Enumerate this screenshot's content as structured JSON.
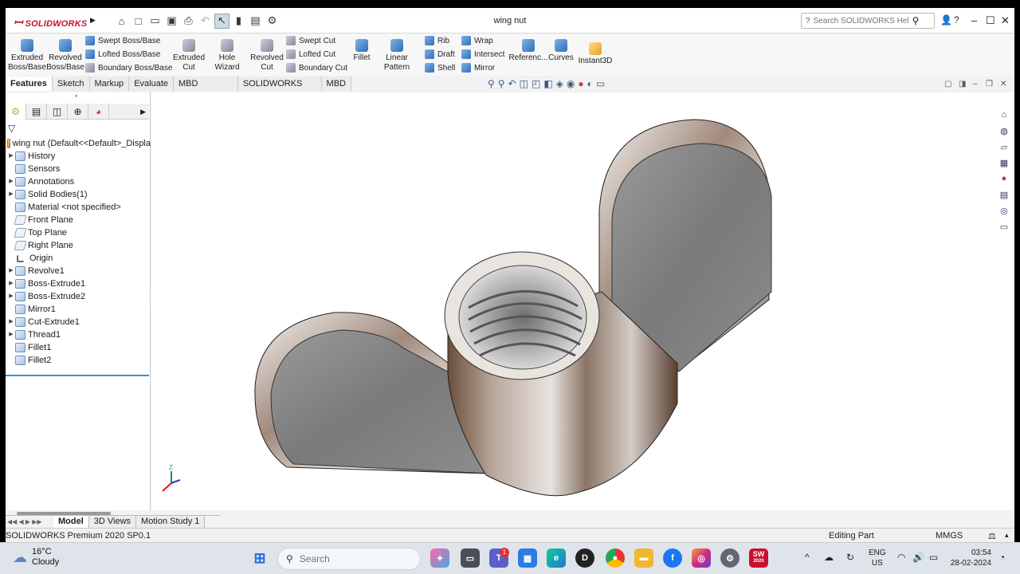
{
  "app": {
    "logo": "SOLIDWORKS",
    "title": "wing nut",
    "help_placeholder": "Search SOLIDWORKS Help"
  },
  "ribbon": {
    "extruded_boss": "Extruded Boss/Base",
    "revolved_boss": "Revolved Boss/Base",
    "swept_boss": "Swept Boss/Base",
    "lofted_boss": "Lofted Boss/Base",
    "boundary_boss": "Boundary Boss/Base",
    "extruded_cut": "Extruded Cut",
    "hole_wizard": "Hole Wizard",
    "revolved_cut": "Revolved Cut",
    "swept_cut": "Swept Cut",
    "lofted_cut": "Lofted Cut",
    "boundary_cut": "Boundary Cut",
    "fillet": "Fillet",
    "linear_pattern": "Linear Pattern",
    "rib": "Rib",
    "draft": "Draft",
    "shell": "Shell",
    "wrap": "Wrap",
    "intersect": "Intersect",
    "mirror": "Mirror",
    "reference": "Referenc...",
    "curves": "Curves",
    "instant3d": "Instant3D"
  },
  "tabs": [
    "Features",
    "Sketch",
    "Markup",
    "Evaluate",
    "MBD Dimensions",
    "SOLIDWORKS Add-Ins",
    "MBD"
  ],
  "tree": {
    "root": "wing nut  (Default<<Default>_Displa",
    "items": [
      "History",
      "Sensors",
      "Annotations",
      "Solid Bodies(1)",
      "Material <not specified>",
      "Front Plane",
      "Top Plane",
      "Right Plane",
      "Origin",
      "Revolve1",
      "Boss-Extrude1",
      "Boss-Extrude2",
      "Mirror1",
      "Cut-Extrude1",
      "Thread1",
      "Fillet1",
      "Fillet2"
    ]
  },
  "bottom_tabs": [
    "Model",
    "3D Views",
    "Motion Study 1"
  ],
  "status": {
    "product": "SOLIDWORKS Premium 2020 SP0.1",
    "mode": "Editing Part",
    "units": "MMGS"
  },
  "taskbar": {
    "temp": "16°C",
    "weather": "Cloudy",
    "search_placeholder": "Search",
    "lang1": "ENG",
    "lang2": "US",
    "time": "03:54",
    "date": "28-02-2024",
    "notif_count": "1",
    "sw_badge": "SW",
    "sw_year": "2020"
  },
  "axes": {
    "z": "Z"
  }
}
